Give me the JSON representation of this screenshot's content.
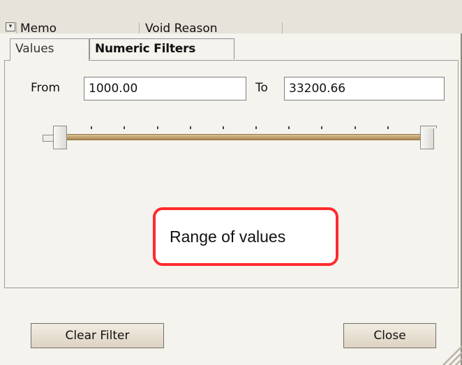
{
  "grid_header": {
    "columns": [
      {
        "label": "Memo"
      },
      {
        "label": "Void Reason"
      }
    ]
  },
  "tabs": [
    {
      "label": "Values",
      "active": true
    },
    {
      "label": "Numeric Filters",
      "active": false
    }
  ],
  "range": {
    "from_label": "From",
    "from_value": "1000.00",
    "to_label": "To",
    "to_value": "33200.66",
    "slider_min_fraction": 0.0,
    "slider_max_fraction": 1.0,
    "tick_count": 10
  },
  "callout": {
    "text": "Range of values",
    "color": "#ff2b2b"
  },
  "buttons": {
    "clear_filter": "Clear Filter",
    "close": "Close"
  }
}
